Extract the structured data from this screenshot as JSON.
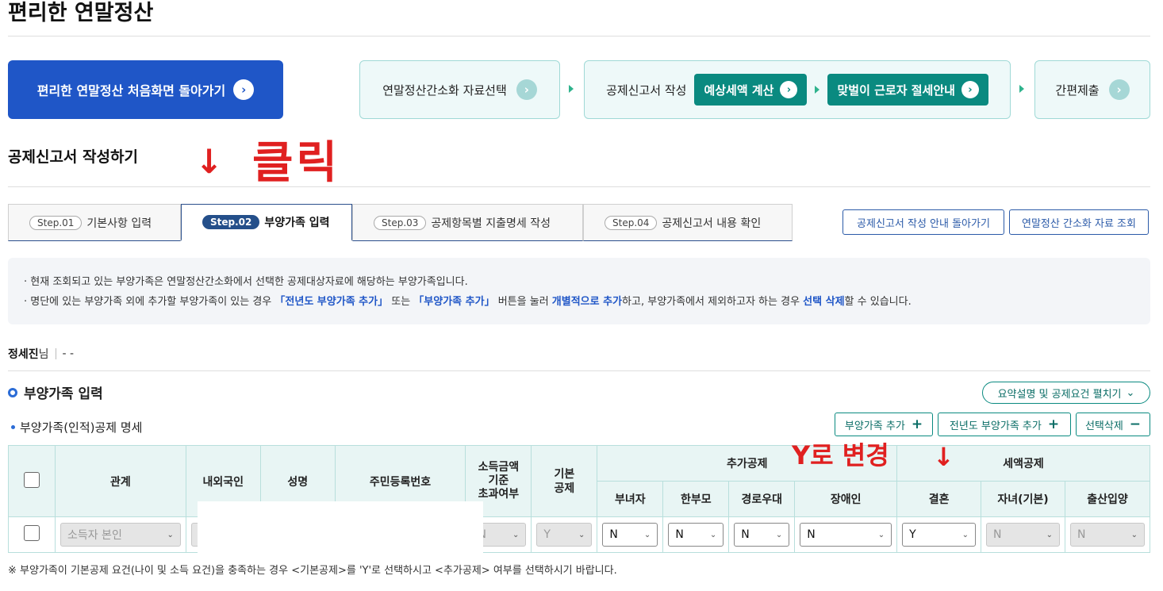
{
  "page": {
    "title": "편리한 연말정산"
  },
  "nav": {
    "home_label": "편리한 연말정산 처음화면 돌아가기",
    "steps": [
      "연말정산간소화 자료선택",
      "공제신고서 작성",
      "예상세액 계산",
      "맞벌이 근로자 절세안내",
      "간편제출"
    ],
    "circle_icon": "›"
  },
  "section": {
    "title": "공제신고서 작성하기"
  },
  "annotations": {
    "arrow": "↓",
    "click": "클릭",
    "change_to_y": "Y로 변경"
  },
  "tabs": [
    {
      "step": "Step.01",
      "label": "기본사항 입력"
    },
    {
      "step": "Step.02",
      "label": "부양가족 입력"
    },
    {
      "step": "Step.03",
      "label": "공제항목별 지출명세 작성"
    },
    {
      "step": "Step.04",
      "label": "공제신고서 내용 확인"
    }
  ],
  "header_buttons": {
    "guide_back": "공제신고서 작성 안내 돌아가기",
    "simple_lookup": "연말정산 간소화 자료 조회"
  },
  "info": {
    "line1": "현재 조회되고 있는 부양가족은 연말정산간소화에서 선택한 공제대상자료에 해당하는 부양가족입니다.",
    "line2_a": "명단에 있는 부양가족 외에 추가할 부양가족이 있는 경우 ",
    "line2_hl1": "「전년도 부양가족 추가」",
    "line2_b": " 또는 ",
    "line2_hl2": "「부양가족 추가」",
    "line2_c": " 버튼을 눌러 ",
    "line2_hl3": "개별적으로 추가",
    "line2_d": "하고, 부양가족에서 제외하고자 하는 경우 ",
    "line2_hl4": "선택 삭제",
    "line2_e": "할 수 있습니다."
  },
  "person": {
    "name": "정세진",
    "suffix": "님",
    "extra": "- -"
  },
  "dependents": {
    "title": "부양가족 입력",
    "summary_button": "요약설명 및 공제요건 펼치기",
    "subtitle": "부양가족(인적)공제 명세",
    "add_button": "부양가족 추가",
    "add_prev_button": "전년도 부양가족 추가",
    "delete_button": "선택삭제"
  },
  "table": {
    "headers": {
      "relation": "관계",
      "nationality": "내외국인",
      "name": "성명",
      "rrn": "주민등록번호",
      "income_over": "소득금액\n기준\n초과여부",
      "basic": "기본\n공제",
      "additional": "추가공제",
      "tax_credit": "세액공제",
      "woman_head": "부녀자",
      "single_parent": "한부모",
      "elderly": "경로우대",
      "disabled": "장애인",
      "marriage": "결혼",
      "child_basic": "자녀(기본)",
      "birth_adoption": "출산입양"
    },
    "row": {
      "relation": "소득자 본인",
      "income_over": "N",
      "basic": "Y",
      "woman_head": "N",
      "single_parent": "N",
      "elderly": "N",
      "disabled": "N",
      "marriage": "Y",
      "child_basic": "N",
      "birth_adoption": "N"
    }
  },
  "footnote": "※ 부양가족이 기본공제 요건(나이 및 소득 요건)을 충족하는 경우 <기본공제>를 'Y'로 선택하시고 <추가공제> 여부를 선택하시기 바랍니다."
}
